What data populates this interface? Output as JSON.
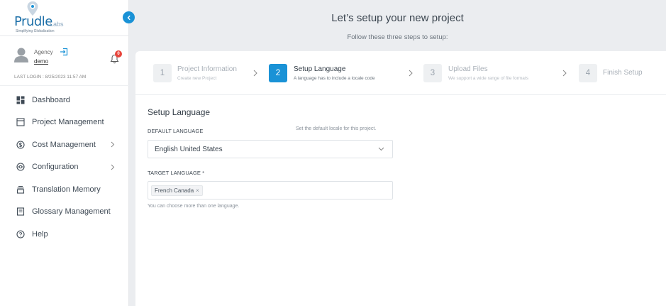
{
  "brand": {
    "name": "Prudle",
    "suffix": "Labs",
    "tagline": "Simplifying Globalization"
  },
  "user": {
    "role": "Agency",
    "name": "demo",
    "notifications": "0",
    "last_login": "LAST LOGIN : 8/25/2023 11:57 AM"
  },
  "nav": {
    "items": [
      {
        "label": "Dashboard",
        "icon": "dashboard-icon"
      },
      {
        "label": "Project Management",
        "icon": "project-icon"
      },
      {
        "label": "Cost Management",
        "icon": "cost-icon",
        "expandable": true
      },
      {
        "label": "Configuration",
        "icon": "configuration-icon",
        "expandable": true
      },
      {
        "label": "Translation Memory",
        "icon": "translation-memory-icon"
      },
      {
        "label": "Glossary Management",
        "icon": "glossary-icon"
      },
      {
        "label": "Help",
        "icon": "help-icon"
      }
    ]
  },
  "header": {
    "title": "Let’s setup your new project",
    "subtitle": "Follow these three steps to setup:"
  },
  "steps": [
    {
      "num": "1",
      "title": "Project Information",
      "desc": "Create new Project",
      "active": false
    },
    {
      "num": "2",
      "title": "Setup Language",
      "desc": "A language has to include a locale code",
      "active": true
    },
    {
      "num": "3",
      "title": "Upload Files",
      "desc": "We support a wide range of file formats",
      "active": false
    },
    {
      "num": "4",
      "title": "Finish Setup",
      "desc": "",
      "active": false
    }
  ],
  "form": {
    "section_title": "Setup Language",
    "default_language": {
      "label": "DEFAULT LANGUAGE",
      "hint": "Set the default locale for this project.",
      "value": "English United States"
    },
    "target_language": {
      "label": "TARGET LANGUAGE *",
      "tags": [
        "French Canada"
      ],
      "remove_glyph": "×",
      "help": "You can choose more than one language."
    }
  },
  "colors": {
    "accent": "#1a92d6",
    "badge": "#e8453c",
    "brand_text": "#1c6fa8"
  }
}
